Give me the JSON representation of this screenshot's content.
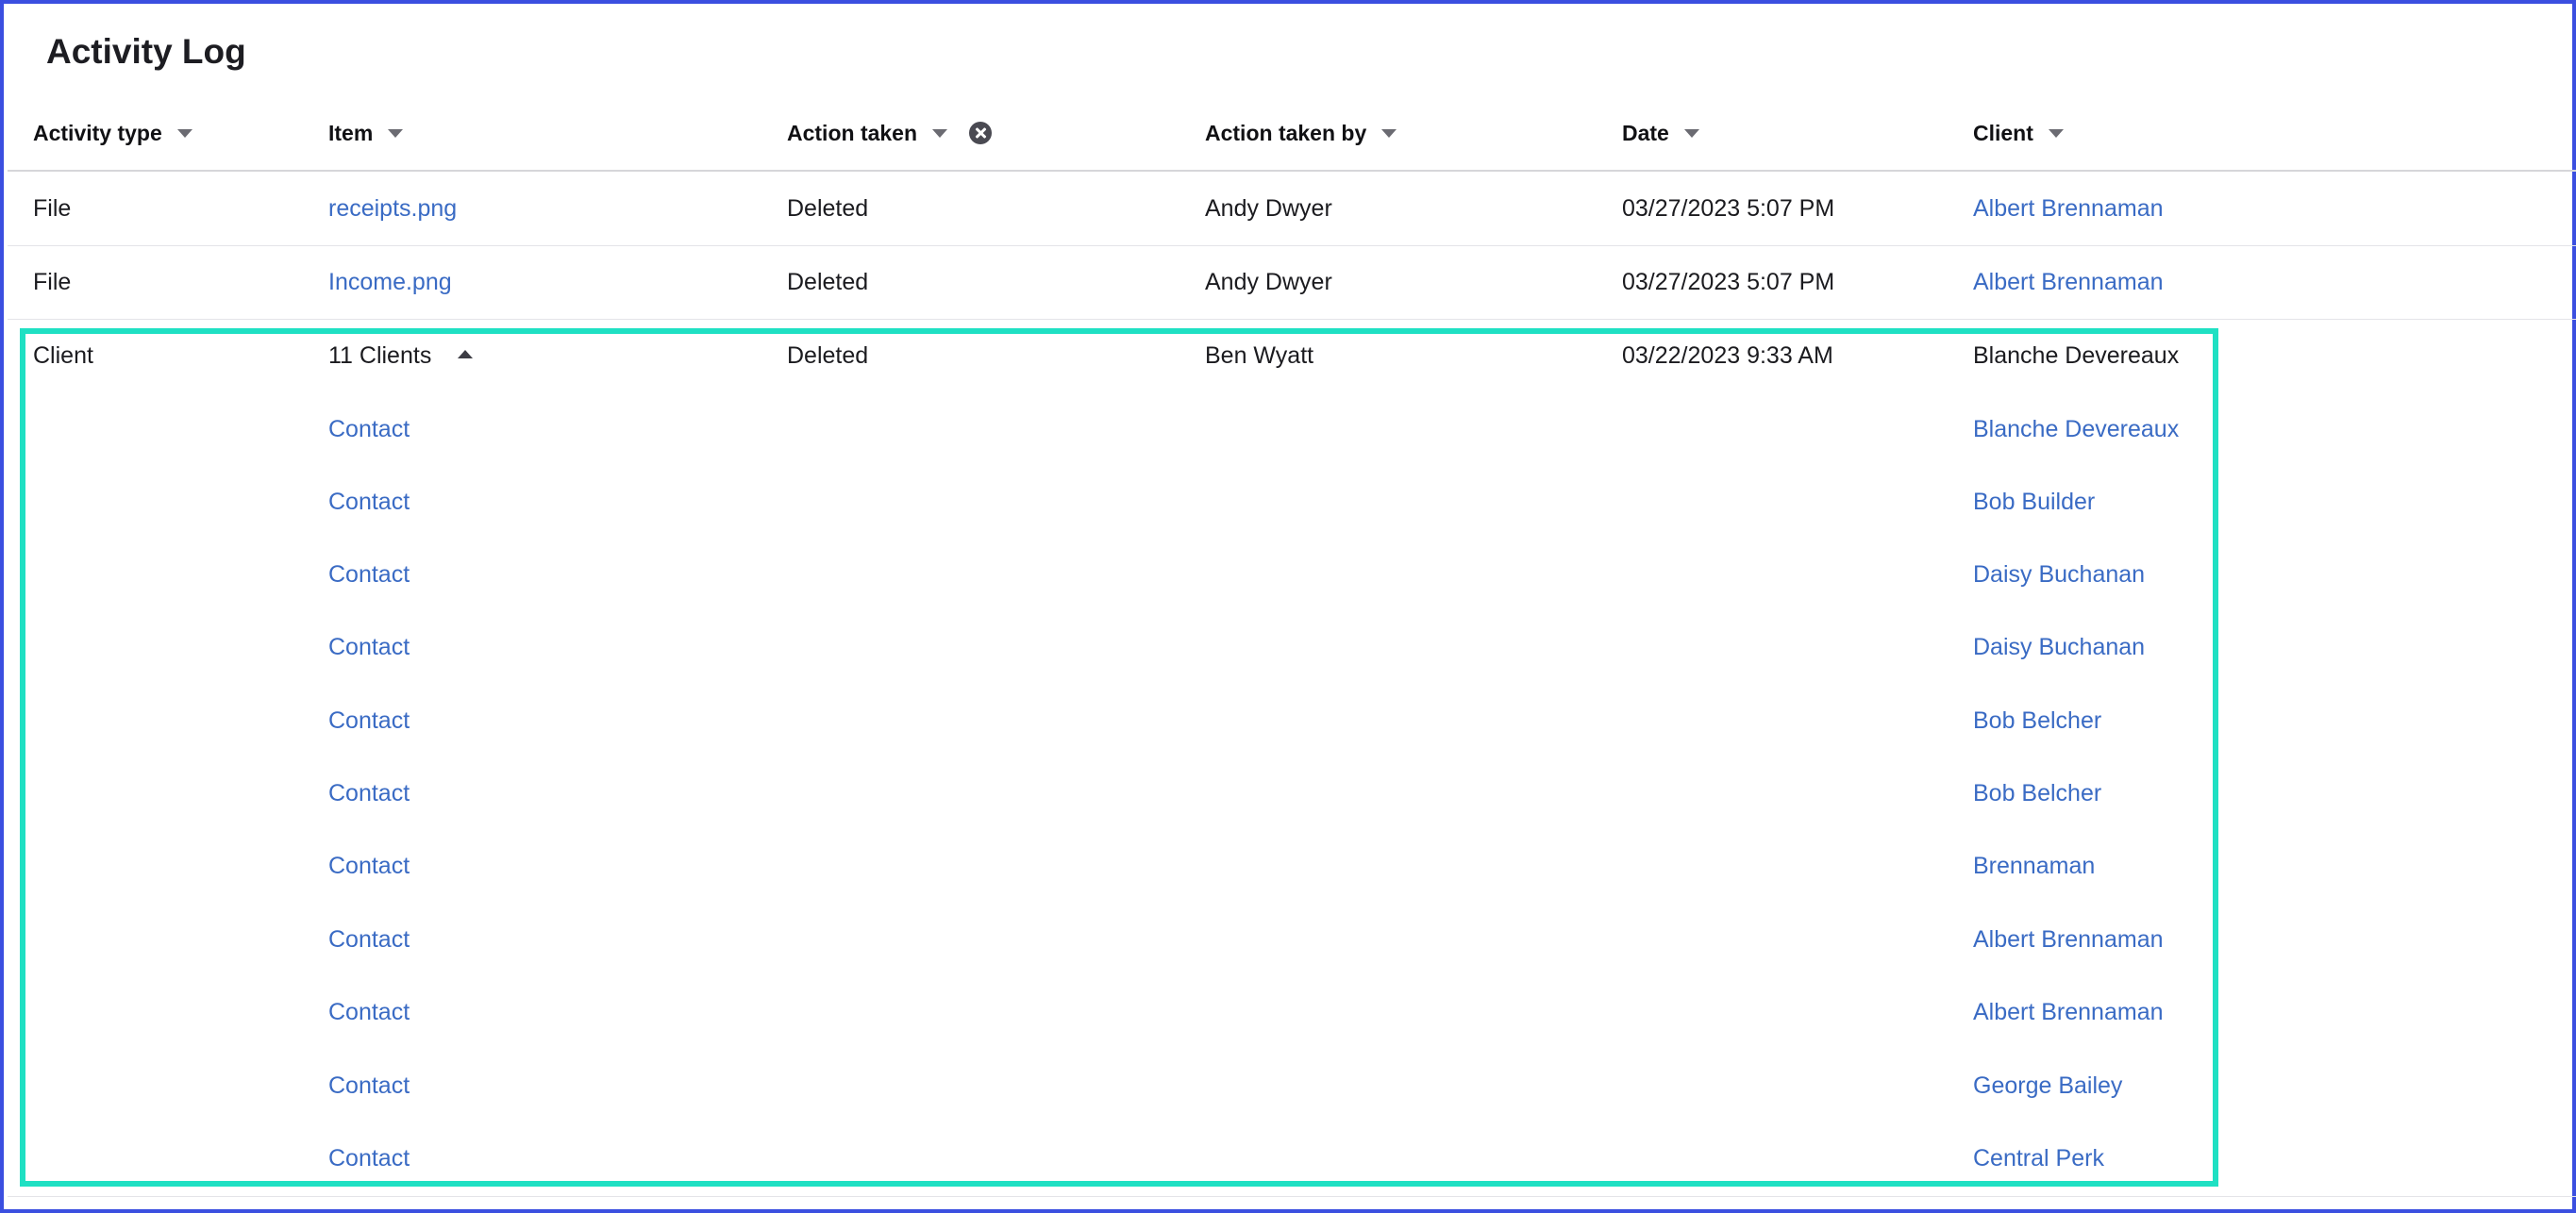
{
  "page": {
    "title": "Activity Log"
  },
  "columns": {
    "activity_type": "Activity type",
    "item": "Item",
    "action_taken": "Action taken",
    "action_taken_by": "Action taken by",
    "date": "Date",
    "client": "Client"
  },
  "icons": {
    "sort": "caret-down-icon",
    "clear_filter": "clear-filter-icon",
    "collapse": "caret-up-icon"
  },
  "colors": {
    "link": "#3a6bc4",
    "highlight": "#1fe0c3",
    "frame": "#3b4fe0"
  },
  "rows": [
    {
      "activity_type": "File",
      "item": "receipts.png",
      "action_taken": "Deleted",
      "action_taken_by": "Andy Dwyer",
      "date": "03/27/2023 5:07 PM",
      "client": "Albert Brennaman"
    },
    {
      "activity_type": "File",
      "item": "Income.png",
      "action_taken": "Deleted",
      "action_taken_by": "Andy Dwyer",
      "date": "03/27/2023 5:07 PM",
      "client": "Albert Brennaman"
    }
  ],
  "group_row": {
    "activity_type": "Client",
    "item": "11 Clients",
    "action_taken": "Deleted",
    "action_taken_by": "Ben Wyatt",
    "date": "03/22/2023 9:33 AM",
    "client": "Blanche Devereaux",
    "children": [
      {
        "item": "Contact",
        "client": "Blanche Devereaux"
      },
      {
        "item": "Contact",
        "client": "Bob Builder"
      },
      {
        "item": "Contact",
        "client": "Daisy Buchanan"
      },
      {
        "item": "Contact",
        "client": "Daisy Buchanan"
      },
      {
        "item": "Contact",
        "client": "Bob Belcher"
      },
      {
        "item": "Contact",
        "client": "Bob Belcher"
      },
      {
        "item": "Contact",
        "client": "Brennaman"
      },
      {
        "item": "Contact",
        "client": "Albert Brennaman"
      },
      {
        "item": "Contact",
        "client": "Albert Brennaman"
      },
      {
        "item": "Contact",
        "client": "George Bailey"
      },
      {
        "item": "Contact",
        "client": "Central Perk"
      }
    ]
  }
}
